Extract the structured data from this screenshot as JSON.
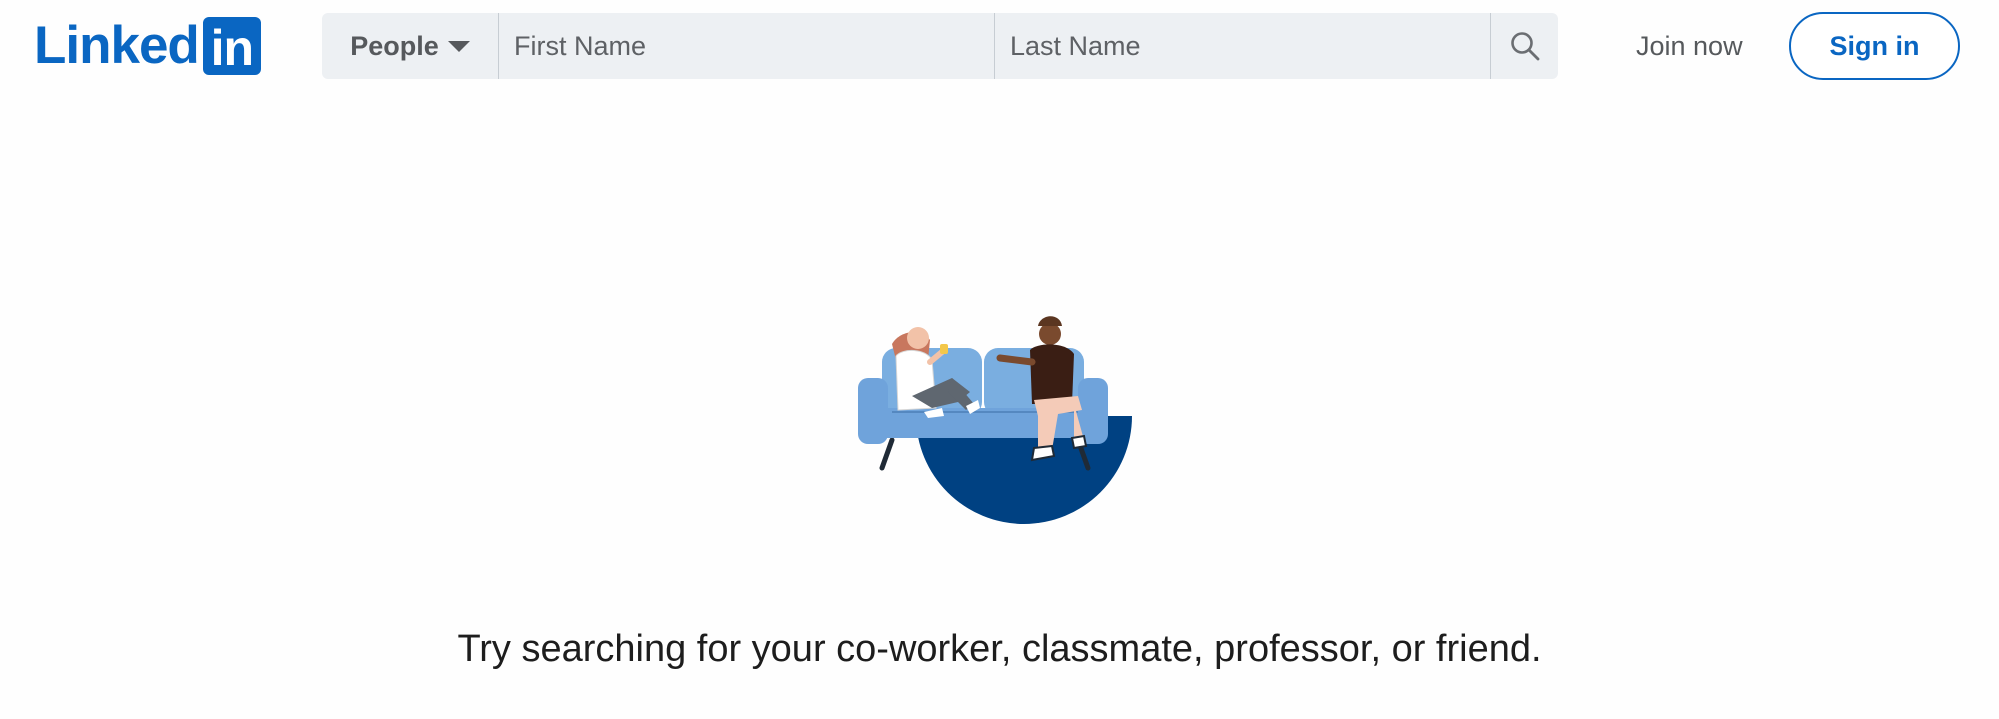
{
  "header": {
    "logo_text": "Linked",
    "logo_box_text": "in",
    "join_label": "Join now",
    "signin_label": "Sign in"
  },
  "search": {
    "type_label": "People",
    "first_name_placeholder": "First Name",
    "last_name_placeholder": "Last Name",
    "submit_icon": "search-icon"
  },
  "main": {
    "prompt": "Try searching for your co-worker, classmate, professor, or friend."
  },
  "colors": {
    "brand": "#0a66c2",
    "search_bg": "#edf0f3",
    "circle": "#004182",
    "sofa": "#6fa3db"
  }
}
